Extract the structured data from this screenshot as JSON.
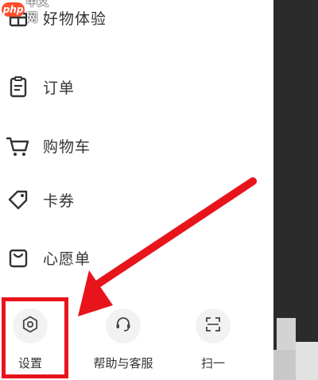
{
  "watermark": {
    "logo_text": "php",
    "site_text": "中文网"
  },
  "menu": {
    "items": [
      {
        "label": "好物体验",
        "icon": "gift-box-icon"
      },
      {
        "label": "订单",
        "icon": "clipboard-icon"
      },
      {
        "label": "购物车",
        "icon": "shopping-cart-icon"
      },
      {
        "label": "卡券",
        "icon": "coupon-tag-icon"
      },
      {
        "label": "心愿单",
        "icon": "wishlist-bag-icon"
      }
    ]
  },
  "bottom_bar": {
    "settings_label": "设置",
    "help_label": "帮助与客服",
    "scan_label": "扫一"
  },
  "colors": {
    "annotation_red": "#e8141c",
    "text": "#333333",
    "right_panel": "#2b2b2b"
  }
}
